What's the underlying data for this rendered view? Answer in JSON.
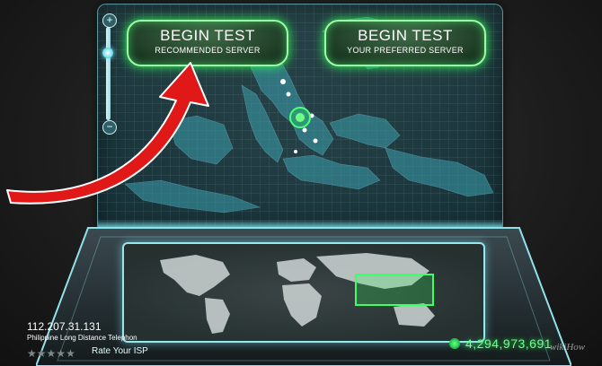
{
  "buttons": {
    "recommended": {
      "title": "BEGIN TEST",
      "subtitle": "RECOMMENDED SERVER"
    },
    "preferred": {
      "title": "BEGIN TEST",
      "subtitle": "YOUR PREFERRED SERVER"
    }
  },
  "zoom": {
    "plus": "+",
    "minus": "−",
    "level": 0.75
  },
  "isp": {
    "ip": "112.207.31.131",
    "name": "Philippine Long Distance Telephon",
    "rating": 0,
    "rate_label": "Rate Your ISP"
  },
  "counter": "4,294,973,691",
  "watermark": "wikiHow",
  "colors": {
    "accent_green": "#2dff55",
    "glass_cyan": "#97e7ef",
    "annotation_red": "#e01818"
  },
  "icons": [
    "zoom-in-icon",
    "zoom-out-icon",
    "server-marker-icon",
    "globe-icon",
    "star-icon",
    "red-arrow-annotation"
  ]
}
